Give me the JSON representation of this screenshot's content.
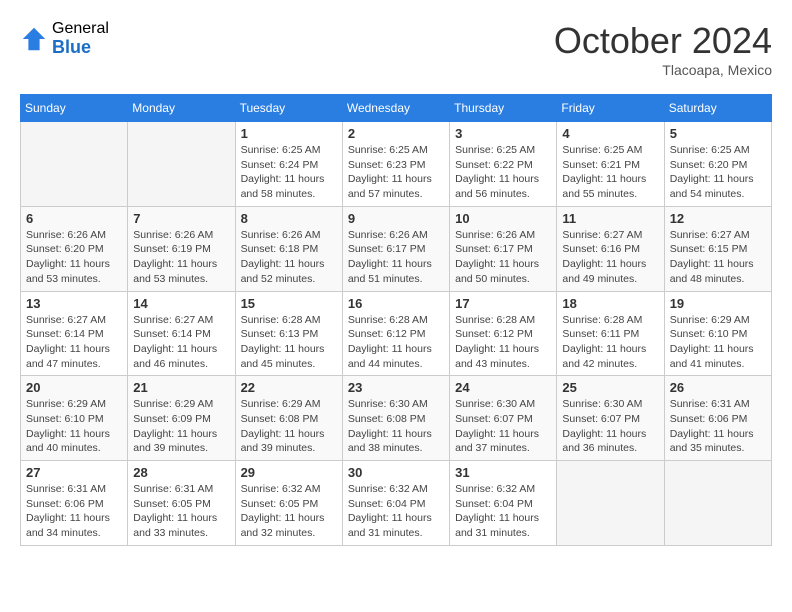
{
  "header": {
    "logo_general": "General",
    "logo_blue": "Blue",
    "month_title": "October 2024",
    "location": "Tlacoapa, Mexico"
  },
  "weekdays": [
    "Sunday",
    "Monday",
    "Tuesday",
    "Wednesday",
    "Thursday",
    "Friday",
    "Saturday"
  ],
  "weeks": [
    [
      {
        "day": "",
        "empty": true
      },
      {
        "day": "",
        "empty": true
      },
      {
        "day": "1",
        "sunrise": "6:25 AM",
        "sunset": "6:24 PM",
        "daylight": "11 hours and 58 minutes."
      },
      {
        "day": "2",
        "sunrise": "6:25 AM",
        "sunset": "6:23 PM",
        "daylight": "11 hours and 57 minutes."
      },
      {
        "day": "3",
        "sunrise": "6:25 AM",
        "sunset": "6:22 PM",
        "daylight": "11 hours and 56 minutes."
      },
      {
        "day": "4",
        "sunrise": "6:25 AM",
        "sunset": "6:21 PM",
        "daylight": "11 hours and 55 minutes."
      },
      {
        "day": "5",
        "sunrise": "6:25 AM",
        "sunset": "6:20 PM",
        "daylight": "11 hours and 54 minutes."
      }
    ],
    [
      {
        "day": "6",
        "sunrise": "6:26 AM",
        "sunset": "6:20 PM",
        "daylight": "11 hours and 53 minutes."
      },
      {
        "day": "7",
        "sunrise": "6:26 AM",
        "sunset": "6:19 PM",
        "daylight": "11 hours and 53 minutes."
      },
      {
        "day": "8",
        "sunrise": "6:26 AM",
        "sunset": "6:18 PM",
        "daylight": "11 hours and 52 minutes."
      },
      {
        "day": "9",
        "sunrise": "6:26 AM",
        "sunset": "6:17 PM",
        "daylight": "11 hours and 51 minutes."
      },
      {
        "day": "10",
        "sunrise": "6:26 AM",
        "sunset": "6:17 PM",
        "daylight": "11 hours and 50 minutes."
      },
      {
        "day": "11",
        "sunrise": "6:27 AM",
        "sunset": "6:16 PM",
        "daylight": "11 hours and 49 minutes."
      },
      {
        "day": "12",
        "sunrise": "6:27 AM",
        "sunset": "6:15 PM",
        "daylight": "11 hours and 48 minutes."
      }
    ],
    [
      {
        "day": "13",
        "sunrise": "6:27 AM",
        "sunset": "6:14 PM",
        "daylight": "11 hours and 47 minutes."
      },
      {
        "day": "14",
        "sunrise": "6:27 AM",
        "sunset": "6:14 PM",
        "daylight": "11 hours and 46 minutes."
      },
      {
        "day": "15",
        "sunrise": "6:28 AM",
        "sunset": "6:13 PM",
        "daylight": "11 hours and 45 minutes."
      },
      {
        "day": "16",
        "sunrise": "6:28 AM",
        "sunset": "6:12 PM",
        "daylight": "11 hours and 44 minutes."
      },
      {
        "day": "17",
        "sunrise": "6:28 AM",
        "sunset": "6:12 PM",
        "daylight": "11 hours and 43 minutes."
      },
      {
        "day": "18",
        "sunrise": "6:28 AM",
        "sunset": "6:11 PM",
        "daylight": "11 hours and 42 minutes."
      },
      {
        "day": "19",
        "sunrise": "6:29 AM",
        "sunset": "6:10 PM",
        "daylight": "11 hours and 41 minutes."
      }
    ],
    [
      {
        "day": "20",
        "sunrise": "6:29 AM",
        "sunset": "6:10 PM",
        "daylight": "11 hours and 40 minutes."
      },
      {
        "day": "21",
        "sunrise": "6:29 AM",
        "sunset": "6:09 PM",
        "daylight": "11 hours and 39 minutes."
      },
      {
        "day": "22",
        "sunrise": "6:29 AM",
        "sunset": "6:08 PM",
        "daylight": "11 hours and 39 minutes."
      },
      {
        "day": "23",
        "sunrise": "6:30 AM",
        "sunset": "6:08 PM",
        "daylight": "11 hours and 38 minutes."
      },
      {
        "day": "24",
        "sunrise": "6:30 AM",
        "sunset": "6:07 PM",
        "daylight": "11 hours and 37 minutes."
      },
      {
        "day": "25",
        "sunrise": "6:30 AM",
        "sunset": "6:07 PM",
        "daylight": "11 hours and 36 minutes."
      },
      {
        "day": "26",
        "sunrise": "6:31 AM",
        "sunset": "6:06 PM",
        "daylight": "11 hours and 35 minutes."
      }
    ],
    [
      {
        "day": "27",
        "sunrise": "6:31 AM",
        "sunset": "6:06 PM",
        "daylight": "11 hours and 34 minutes."
      },
      {
        "day": "28",
        "sunrise": "6:31 AM",
        "sunset": "6:05 PM",
        "daylight": "11 hours and 33 minutes."
      },
      {
        "day": "29",
        "sunrise": "6:32 AM",
        "sunset": "6:05 PM",
        "daylight": "11 hours and 32 minutes."
      },
      {
        "day": "30",
        "sunrise": "6:32 AM",
        "sunset": "6:04 PM",
        "daylight": "11 hours and 31 minutes."
      },
      {
        "day": "31",
        "sunrise": "6:32 AM",
        "sunset": "6:04 PM",
        "daylight": "11 hours and 31 minutes."
      },
      {
        "day": "",
        "empty": true
      },
      {
        "day": "",
        "empty": true
      }
    ]
  ],
  "labels": {
    "sunrise": "Sunrise:",
    "sunset": "Sunset:",
    "daylight": "Daylight:"
  }
}
